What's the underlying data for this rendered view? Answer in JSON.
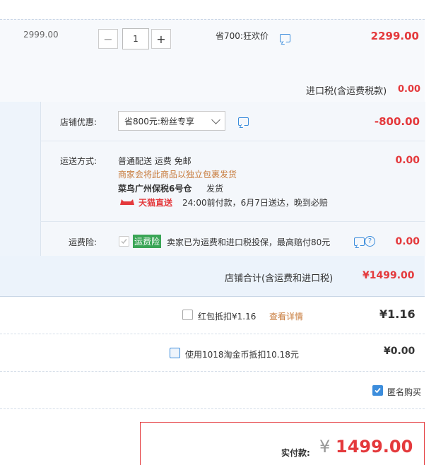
{
  "item": {
    "original_price": "2999.00",
    "quantity": "1",
    "minus": "−",
    "plus": "+",
    "promo": "省700:狂欢价",
    "price": "2299.00",
    "import_tax_label": "进口税(含运费税款)",
    "import_tax_value": "0.00"
  },
  "shop": {
    "discount_label": "店铺优惠:",
    "discount_select": "省800元:粉丝专享",
    "discount_value": "-800.00",
    "shipping_label": "运送方式:",
    "shipping_method": "普通配送 运费 免邮",
    "shipping_note": "商家会将此商品以独立包裹发货",
    "warehouse": "菜鸟广州保税6号仓",
    "ship_verb": "发货",
    "tmall_badge": "天猫直送",
    "delivery_promise": "24:00前付款，6月7日送达，晚到必赔",
    "shipping_value": "0.00",
    "insurance_label": "运费险:",
    "insurance_tag": "运费险",
    "insurance_text": "卖家已为运费和进口税投保，最高赔付80元",
    "insurance_value": "0.00",
    "total_label": "店铺合计(含运费和进口税)",
    "total_value": "¥1499.00"
  },
  "deductions": {
    "redpacket_label": "红包抵扣¥1.16",
    "redpacket_link": "查看详情",
    "redpacket_value": "¥1.16",
    "coin_label": "使用1018淘金币抵扣10.18元",
    "coin_value": "¥0.00",
    "anonymous_label": "匿名购买"
  },
  "payment": {
    "label": "实付款:",
    "currency": "¥",
    "amount": "1499.00"
  },
  "colors": {
    "accent_red": "#e4393c",
    "link_blue": "#3c8ddc",
    "green_tag": "#3aa556"
  }
}
